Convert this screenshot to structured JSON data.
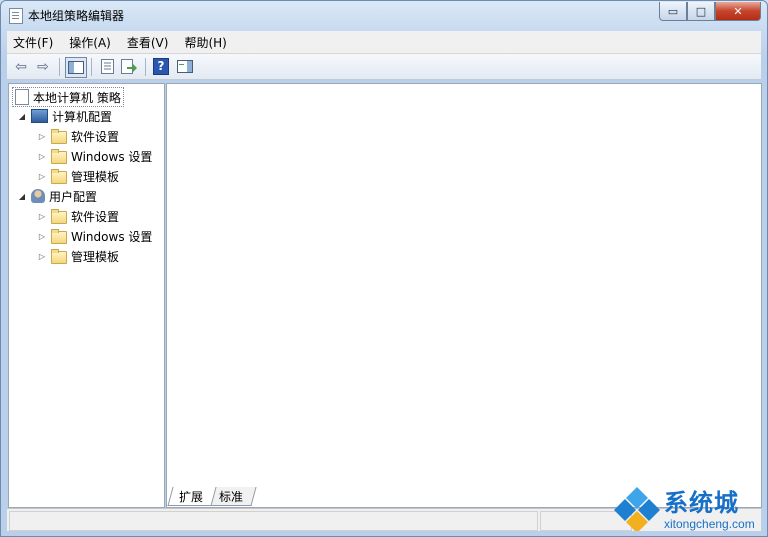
{
  "window": {
    "title": "本地组策略编辑器"
  },
  "caption": {
    "minimize": "▭",
    "maximize": "□",
    "close": "✕"
  },
  "menu": [
    "文件(F)",
    "操作(A)",
    "查看(V)",
    "帮助(H)"
  ],
  "toolbar": {
    "buttons": [
      "back-arrow-icon",
      "forward-arrow-icon",
      "show-hide-console-tree-icon",
      "properties-icon",
      "export-list-icon",
      "help-icon",
      "show-action-pane-icon"
    ],
    "back": "⇦",
    "forward": "⇨",
    "help": "?"
  },
  "tree": {
    "root": "本地计算机 策略",
    "computer": {
      "label": "计算机配置",
      "children": [
        "软件设置",
        "Windows 设置",
        "管理模板"
      ]
    },
    "user": {
      "label": "用户配置",
      "children": [
        "软件设置",
        "Windows 设置",
        "管理模板"
      ]
    }
  },
  "tabs": [
    "扩展",
    "标准"
  ],
  "watermark": {
    "brand": "系统城",
    "url": "xitongcheng.com"
  },
  "colors": {
    "accent": "#1770c8",
    "window_frame": "#b9cfea"
  }
}
